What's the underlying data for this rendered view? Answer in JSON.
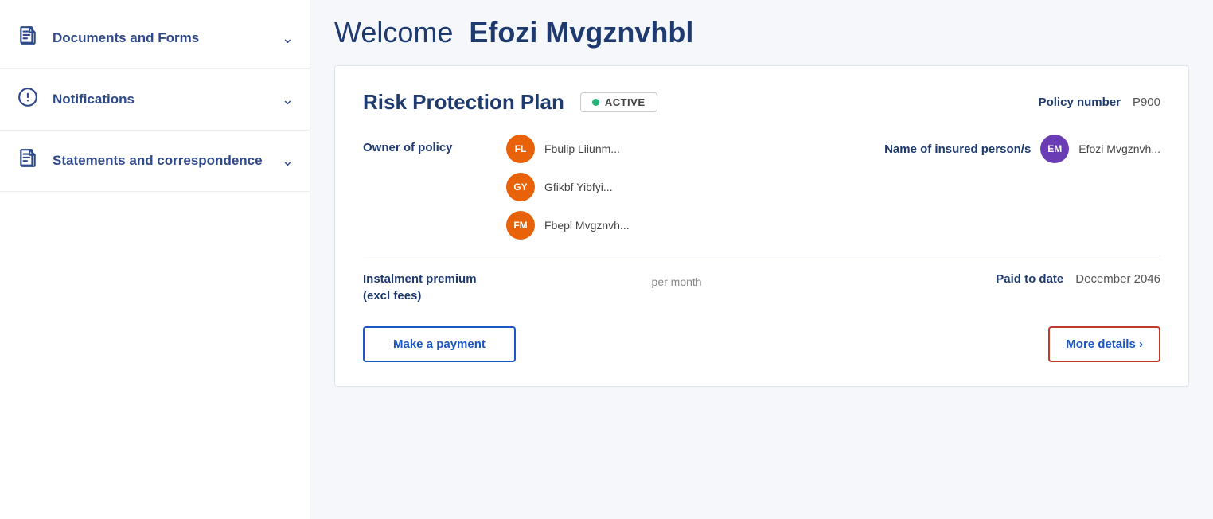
{
  "sidebar": {
    "items": [
      {
        "id": "documents-and-forms",
        "label": "Documents and Forms",
        "icon": "📄",
        "chevron": "∨"
      },
      {
        "id": "notifications",
        "label": "Notifications",
        "icon": "⊙",
        "chevron": "∨"
      },
      {
        "id": "statements-and-correspondence",
        "label": "Statements and correspondence",
        "icon": "📄",
        "chevron": "∨"
      }
    ]
  },
  "header": {
    "welcome_label": "Welcome",
    "user_name": "Efozi Mvgznvhbl"
  },
  "policy": {
    "title": "Risk Protection Plan",
    "status": "ACTIVE",
    "policy_number_label": "Policy number",
    "policy_number_value": "P900",
    "owner_label": "Owner of policy",
    "owners": [
      {
        "initials": "FL",
        "name": "Fbulip Liiunm...",
        "color": "avatar-fl"
      },
      {
        "initials": "GY",
        "name": "Gfikbf Yibfyi...",
        "color": "avatar-gy"
      },
      {
        "initials": "FM",
        "name": "Fbepl Mvgznvh...",
        "color": "avatar-fm"
      }
    ],
    "insured_label": "Name of insured person/s",
    "insured_initials": "EM",
    "insured_name": "Efozi Mvgznvh...",
    "premium_label": "Instalment premium\n(excl fees)",
    "premium_label_line1": "Instalment premium",
    "premium_label_line2": "(excl fees)",
    "per_month": "per month",
    "paid_to_date_label": "Paid to date",
    "paid_to_date_value": "December 2046",
    "make_payment_label": "Make a payment",
    "more_details_label": "More details",
    "chevron_right": "›"
  }
}
